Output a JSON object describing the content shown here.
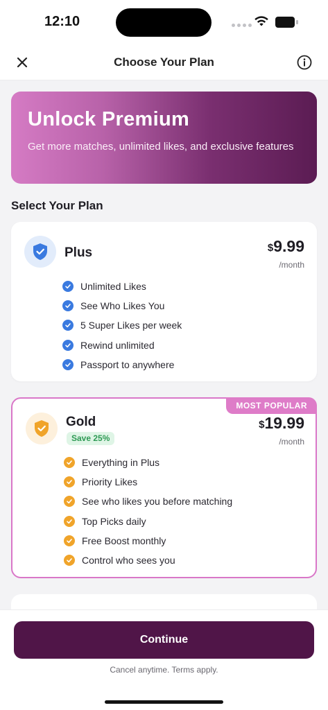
{
  "status_bar": {
    "time": "12:10"
  },
  "header": {
    "title": "Choose Your Plan",
    "close_icon": "close-icon",
    "info_icon": "info-icon"
  },
  "hero": {
    "title": "Unlock Premium",
    "subtitle": "Get more matches, unlimited likes, and exclusive features",
    "gradient": [
      "#d57bc4",
      "#5b1c53"
    ]
  },
  "section_title": "Select Your Plan",
  "plans": [
    {
      "name": "Plus",
      "icon": "shield-check-icon",
      "accent": "#3a7ae0",
      "currency": "$",
      "price": "9.99",
      "period": "/month",
      "features": [
        "Unlimited Likes",
        "See Who Likes You",
        "5 Super Likes per week",
        "Rewind unlimited",
        "Passport to anywhere"
      ]
    },
    {
      "name": "Gold",
      "icon": "shield-check-icon",
      "accent": "#f0a42a",
      "badge": "Save 25%",
      "tag": "MOST POPULAR",
      "currency": "$",
      "price": "19.99",
      "period": "/month",
      "selected": true,
      "features": [
        "Everything in Plus",
        "Priority Likes",
        "See who likes you before matching",
        "Top Picks daily",
        "Free Boost monthly",
        "Control who sees you"
      ]
    }
  ],
  "footer": {
    "button_label": "Continue",
    "button_color": "#501548",
    "note": "Cancel anytime. Terms apply."
  }
}
